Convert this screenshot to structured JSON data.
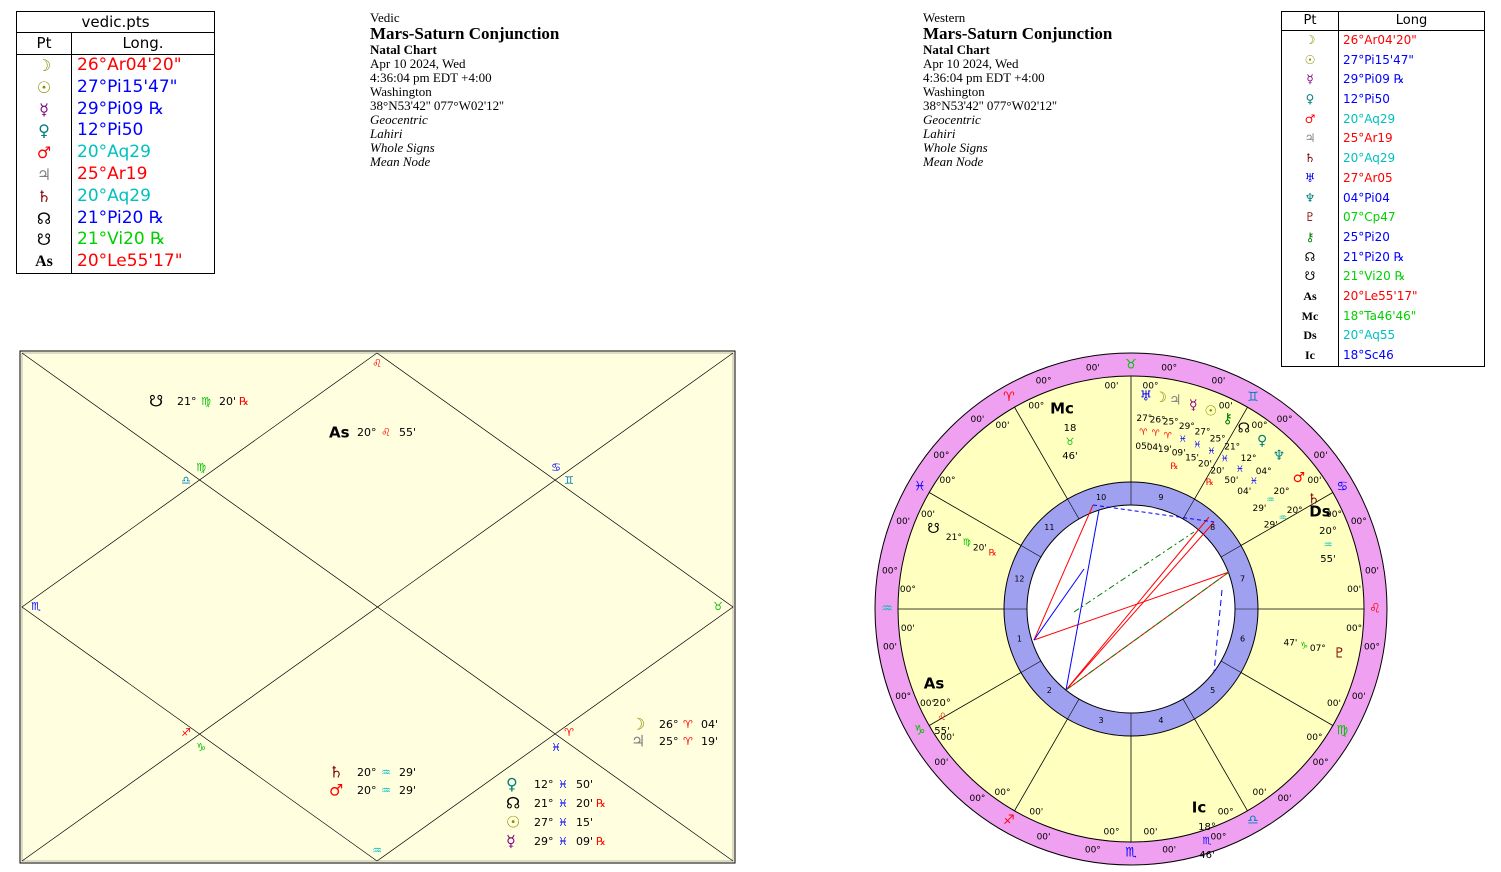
{
  "vedic_table": {
    "title": "vedic.pts",
    "col_pt": "Pt",
    "col_long": "Long.",
    "rows": [
      {
        "glyph": "☽",
        "value": "26°Ar04'20\"",
        "color": "#ff0000",
        "gcolor": "#8b8b00"
      },
      {
        "glyph": "☉",
        "value": "27°Pi15'47\"",
        "color": "#0000ff",
        "gcolor": "#8b8b00"
      },
      {
        "glyph": "☿",
        "value": "29°Pi09 ℞",
        "color": "#0000ff",
        "gcolor": "#800080"
      },
      {
        "glyph": "♀",
        "value": "12°Pi50",
        "color": "#0000ff",
        "gcolor": "#008080"
      },
      {
        "glyph": "♂",
        "value": "20°Aq29",
        "color": "#00c0c0",
        "gcolor": "#ff0000"
      },
      {
        "glyph": "♃",
        "value": "25°Ar19",
        "color": "#ff0000",
        "gcolor": "#808080"
      },
      {
        "glyph": "♄",
        "value": "20°Aq29",
        "color": "#00c0c0",
        "gcolor": "#800000"
      },
      {
        "glyph": "☊",
        "value": "21°Pi20 ℞",
        "color": "#0000ff",
        "gcolor": "#000000"
      },
      {
        "glyph": "☋",
        "value": "21°Vi20 ℞",
        "color": "#00d000",
        "gcolor": "#000000"
      },
      {
        "glyph": "As",
        "value": "20°Le55'17\"",
        "color": "#ff0000",
        "gcolor": "#000000"
      }
    ]
  },
  "vedic_info": {
    "label": "Vedic",
    "title": "Mars-Saturn Conjunction",
    "subtitle": "Natal Chart",
    "date": "Apr 10 2024, Wed",
    "time": "4:36:04 pm  EDT +4:00",
    "place": "Washington",
    "coords": "38°N53'42'' 077°W02'12''",
    "l1": "Geocentric",
    "l2": "Lahiri",
    "l3": "Whole Signs",
    "l4": "Mean Node"
  },
  "western_info": {
    "label": "Western",
    "title": "Mars-Saturn Conjunction",
    "subtitle": "Natal Chart",
    "date": "Apr 10 2024, Wed",
    "time": "4:36:04 pm  EDT +4:00",
    "place": "Washington",
    "coords": "38°N53'42'' 077°W02'12''",
    "l1": "Geocentric",
    "l2": "Lahiri",
    "l3": "Whole Signs",
    "l4": "Mean Node"
  },
  "western_table": {
    "col_pt": "Pt",
    "col_long": "Long",
    "rows": [
      {
        "glyph": "☽",
        "value": "26°Ar04'20\"",
        "color": "#ff0000",
        "gcolor": "#8b8b00"
      },
      {
        "glyph": "☉",
        "value": "27°Pi15'47\"",
        "color": "#0000ff",
        "gcolor": "#8b8b00"
      },
      {
        "glyph": "☿",
        "value": "29°Pi09 ℞",
        "color": "#0000ff",
        "gcolor": "#800080"
      },
      {
        "glyph": "♀",
        "value": "12°Pi50",
        "color": "#0000ff",
        "gcolor": "#008080"
      },
      {
        "glyph": "♂",
        "value": "20°Aq29",
        "color": "#00c0c0",
        "gcolor": "#ff0000"
      },
      {
        "glyph": "♃",
        "value": "25°Ar19",
        "color": "#ff0000",
        "gcolor": "#808080"
      },
      {
        "glyph": "♄",
        "value": "20°Aq29",
        "color": "#00c0c0",
        "gcolor": "#800000"
      },
      {
        "glyph": "♅",
        "value": "27°Ar05",
        "color": "#ff0000",
        "gcolor": "#0000ff"
      },
      {
        "glyph": "♆",
        "value": "04°Pi04",
        "color": "#0000ff",
        "gcolor": "#008080"
      },
      {
        "glyph": "♇",
        "value": "07°Cp47",
        "color": "#00d000",
        "gcolor": "#800000"
      },
      {
        "glyph": "⚷",
        "value": "25°Pi20",
        "color": "#0000ff",
        "gcolor": "#008000"
      },
      {
        "glyph": "☊",
        "value": "21°Pi20 ℞",
        "color": "#0000ff",
        "gcolor": "#000000"
      },
      {
        "glyph": "☋",
        "value": "21°Vi20 ℞",
        "color": "#00d000",
        "gcolor": "#000000"
      },
      {
        "glyph": "As",
        "value": "20°Le55'17\"",
        "color": "#ff0000",
        "gcolor": "#000000"
      },
      {
        "glyph": "Mc",
        "value": "18°Ta46'46\"",
        "color": "#00d000",
        "gcolor": "#000000"
      },
      {
        "glyph": "Ds",
        "value": "20°Aq55",
        "color": "#00c0c0",
        "gcolor": "#000000"
      },
      {
        "glyph": "Ic",
        "value": "18°Sc46",
        "color": "#0000ff",
        "gcolor": "#000000"
      }
    ]
  },
  "vedic_chart": {
    "sign_markers": [
      {
        "glyph": "♌",
        "color": "#ff0000"
      },
      {
        "glyph": "♍",
        "color": "#00c000"
      },
      {
        "glyph": "♎",
        "color": "#0080c0"
      },
      {
        "glyph": "♋",
        "color": "#0000ff"
      },
      {
        "glyph": "♊",
        "color": "#0080c0"
      },
      {
        "glyph": "♏",
        "color": "#0000ff"
      },
      {
        "glyph": "♉",
        "color": "#00c000"
      },
      {
        "glyph": "♐",
        "color": "#ff0000"
      },
      {
        "glyph": "♑",
        "color": "#00c000"
      },
      {
        "glyph": "♒",
        "color": "#00c0c0"
      },
      {
        "glyph": "♓",
        "color": "#0000ff"
      },
      {
        "glyph": "♈",
        "color": "#ff0000"
      }
    ],
    "placements": [
      {
        "glyph": "☋",
        "gcolor": "#000000",
        "deg": "21°",
        "sign": "♍",
        "scolor": "#00c000",
        "min": "20'",
        "retro": "℞"
      },
      {
        "glyph": "As",
        "gcolor": "#000000",
        "deg": "20°",
        "sign": "♌",
        "scolor": "#ff0000",
        "min": "55'",
        "retro": ""
      },
      {
        "glyph": "☽",
        "gcolor": "#8b8b00",
        "deg": "26°",
        "sign": "♈",
        "scolor": "#ff0000",
        "min": "04'",
        "retro": ""
      },
      {
        "glyph": "♃",
        "gcolor": "#808080",
        "deg": "25°",
        "sign": "♈",
        "scolor": "#ff0000",
        "min": "19'",
        "retro": ""
      },
      {
        "glyph": "♄",
        "gcolor": "#800000",
        "deg": "20°",
        "sign": "♒",
        "scolor": "#00c0c0",
        "min": "29'",
        "retro": ""
      },
      {
        "glyph": "♂",
        "gcolor": "#ff0000",
        "deg": "20°",
        "sign": "♒",
        "scolor": "#00c0c0",
        "min": "29'",
        "retro": ""
      },
      {
        "glyph": "♀",
        "gcolor": "#008080",
        "deg": "12°",
        "sign": "♓",
        "scolor": "#0000ff",
        "min": "50'",
        "retro": ""
      },
      {
        "glyph": "☊",
        "gcolor": "#000000",
        "deg": "21°",
        "sign": "♓",
        "scolor": "#0000ff",
        "min": "20'",
        "retro": "℞"
      },
      {
        "glyph": "☉",
        "gcolor": "#8b8b00",
        "deg": "27°",
        "sign": "♓",
        "scolor": "#0000ff",
        "min": "15'",
        "retro": ""
      },
      {
        "glyph": "☿",
        "gcolor": "#800080",
        "deg": "29°",
        "sign": "♓",
        "scolor": "#0000ff",
        "min": "09'",
        "retro": "℞"
      }
    ]
  },
  "wheel": {
    "outer_ring_color": "#f0a0f0",
    "inner_fill": "#ffffc0",
    "hub_color": "#a0a0f0",
    "zodiac": [
      {
        "glyph": "♉",
        "color": "#00c000",
        "a": "00'",
        "b": "00°"
      },
      {
        "glyph": "♈",
        "color": "#ff0000",
        "a": "00'",
        "b": "00°"
      },
      {
        "glyph": "♓",
        "color": "#0000ff",
        "a": "00'",
        "b": "00°"
      },
      {
        "glyph": "♒",
        "color": "#00c0c0",
        "a": "00'",
        "b": "00°"
      },
      {
        "glyph": "♑",
        "color": "#00c000",
        "a": "00'",
        "b": "00°"
      },
      {
        "glyph": "♐",
        "color": "#ff0000",
        "a": "00'",
        "b": "00°"
      },
      {
        "glyph": "♏",
        "color": "#0000ff",
        "a": "00'",
        "b": "00°"
      },
      {
        "glyph": "♎",
        "color": "#0080c0",
        "a": "00'",
        "b": "00°"
      },
      {
        "glyph": "♍",
        "color": "#00c000",
        "a": "00'",
        "b": "00°"
      },
      {
        "glyph": "♌",
        "color": "#ff0000",
        "a": "00'",
        "b": "00°"
      },
      {
        "glyph": "♋",
        "color": "#0000ff",
        "a": "00'",
        "b": "00°"
      },
      {
        "glyph": "♊",
        "color": "#0080c0",
        "a": "00'",
        "b": "00°"
      }
    ],
    "houses": [
      "1",
      "2",
      "3",
      "4",
      "5",
      "6",
      "7",
      "8",
      "9",
      "10",
      "11",
      "12"
    ],
    "angles": [
      {
        "glyph": "Mc",
        "deg": "18",
        "sign": "♉",
        "scolor": "#00c000",
        "min": "46'"
      },
      {
        "glyph": "Ic",
        "deg": "18°",
        "sign": "♏",
        "scolor": "#0000ff",
        "min": "46'"
      },
      {
        "glyph": "As",
        "deg": "20°",
        "sign": "♌",
        "scolor": "#ff0000",
        "min": "55'"
      },
      {
        "glyph": "Ds",
        "deg": "20°",
        "sign": "♒",
        "scolor": "#00c0c0",
        "min": "55'"
      }
    ],
    "planets": [
      {
        "glyph": "♅",
        "color": "#0000ff",
        "deg": "27°",
        "sign": "♈",
        "min": "05'",
        "scolor": "#ff0000",
        "retro": ""
      },
      {
        "glyph": "☽",
        "color": "#8b8b00",
        "deg": "26°",
        "sign": "♈",
        "min": "04'",
        "scolor": "#ff0000",
        "retro": ""
      },
      {
        "glyph": "♃",
        "color": "#808080",
        "deg": "25°",
        "sign": "♈",
        "min": "19'",
        "scolor": "#ff0000",
        "retro": ""
      },
      {
        "glyph": "☿",
        "color": "#800080",
        "deg": "29°",
        "sign": "♓",
        "min": "09'",
        "scolor": "#0000ff",
        "retro": "℞"
      },
      {
        "glyph": "☉",
        "color": "#8b8b00",
        "deg": "27°",
        "sign": "♓",
        "min": "15'",
        "scolor": "#0000ff",
        "retro": ""
      },
      {
        "glyph": "⚷",
        "color": "#008000",
        "deg": "25°",
        "sign": "♓",
        "min": "20'",
        "scolor": "#0000ff",
        "retro": ""
      },
      {
        "glyph": "☊",
        "color": "#000000",
        "deg": "21°",
        "sign": "♓",
        "min": "20'",
        "scolor": "#0000ff",
        "retro": "℞"
      },
      {
        "glyph": "♀",
        "color": "#008080",
        "deg": "12°",
        "sign": "♓",
        "min": "50'",
        "scolor": "#0000ff",
        "retro": ""
      },
      {
        "glyph": "♆",
        "color": "#008080",
        "deg": "04°",
        "sign": "♓",
        "min": "04'",
        "scolor": "#0000ff",
        "retro": ""
      },
      {
        "glyph": "♂",
        "color": "#ff0000",
        "deg": "20°",
        "sign": "♒",
        "min": "29'",
        "scolor": "#00c0c0",
        "retro": ""
      },
      {
        "glyph": "♄",
        "color": "#800000",
        "deg": "20°",
        "sign": "♒",
        "min": "29'",
        "scolor": "#00c0c0",
        "retro": ""
      },
      {
        "glyph": "♇",
        "color": "#800000",
        "deg": "07°",
        "sign": "♑",
        "min": "47'",
        "scolor": "#00c000",
        "retro": ""
      },
      {
        "glyph": "☋",
        "color": "#000000",
        "deg": "21°",
        "sign": "♍",
        "min": "20'",
        "scolor": "#00c000",
        "retro": "℞"
      }
    ]
  }
}
